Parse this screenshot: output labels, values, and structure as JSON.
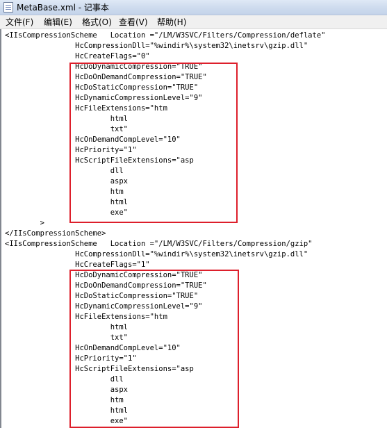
{
  "window": {
    "title": "MetaBase.xml - 记事本"
  },
  "menu": {
    "items": [
      {
        "label": "文件(F)"
      },
      {
        "label": "编辑(E)"
      },
      {
        "label": "格式(O)"
      },
      {
        "label": "查看(V)"
      },
      {
        "label": "帮助(H)"
      }
    ]
  },
  "document": {
    "lines": [
      "<IIsCompressionScheme   Location =\"/LM/W3SVC/Filters/Compression/deflate\"",
      "                HcCompressionDll=\"%windir%\\system32\\inetsrv\\gzip.dll\"",
      "                HcCreateFlags=\"0\"",
      "                HcDoDynamicCompression=\"TRUE\"",
      "                HcDoOnDemandCompression=\"TRUE\"",
      "                HcDoStaticCompression=\"TRUE\"",
      "                HcDynamicCompressionLevel=\"9\"",
      "                HcFileExtensions=\"htm",
      "                        html",
      "                        txt\"",
      "                HcOnDemandCompLevel=\"10\"",
      "                HcPriority=\"1\"",
      "                HcScriptFileExtensions=\"asp",
      "                        dll",
      "                        aspx",
      "                        htm",
      "                        html",
      "                        exe\"",
      "        >",
      "</IIsCompressionScheme>",
      "<IIsCompressionScheme   Location =\"/LM/W3SVC/Filters/Compression/gzip\"",
      "                HcCompressionDll=\"%windir%\\system32\\inetsrv\\gzip.dll\"",
      "                HcCreateFlags=\"1\"",
      "                HcDoDynamicCompression=\"TRUE\"",
      "                HcDoOnDemandCompression=\"TRUE\"",
      "                HcDoStaticCompression=\"TRUE\"",
      "                HcDynamicCompressionLevel=\"9\"",
      "                HcFileExtensions=\"htm",
      "                        html",
      "                        txt\"",
      "                HcOnDemandCompLevel=\"10\"",
      "                HcPriority=\"1\"",
      "                HcScriptFileExtensions=\"asp",
      "                        dll",
      "                        aspx",
      "                        htm",
      "                        html",
      "                        exe\"",
      "        >"
    ]
  },
  "highlight_color": "#dd1f2b"
}
